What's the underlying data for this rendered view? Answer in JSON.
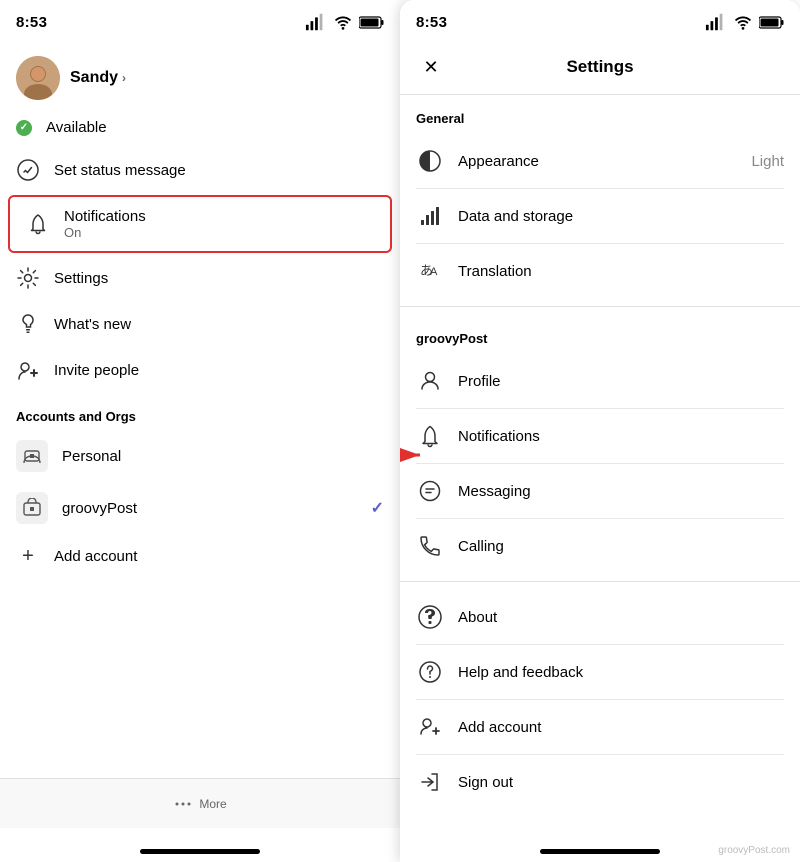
{
  "left": {
    "statusBar": {
      "time": "8:53",
      "signal": "▌▌▌",
      "wifi": "WiFi",
      "battery": "🔋"
    },
    "user": {
      "name": "Sandy",
      "chevron": "›"
    },
    "menuItems": [
      {
        "id": "available",
        "icon": "dot-green",
        "label": "Available",
        "sublabel": ""
      },
      {
        "id": "status",
        "icon": "pencil-circle",
        "label": "Set status message",
        "sublabel": ""
      },
      {
        "id": "notifications",
        "icon": "bell",
        "label": "Notifications",
        "sublabel": "On",
        "highlighted": true
      },
      {
        "id": "settings",
        "icon": "gear",
        "label": "Settings",
        "sublabel": ""
      },
      {
        "id": "whats-new",
        "icon": "bulb",
        "label": "What's new",
        "sublabel": ""
      },
      {
        "id": "invite",
        "icon": "person-plus",
        "label": "Invite people",
        "sublabel": ""
      }
    ],
    "accountsTitle": "Accounts and Orgs",
    "accounts": [
      {
        "id": "personal",
        "icon": "home",
        "label": "Personal",
        "check": false
      },
      {
        "id": "groovypost",
        "icon": "briefcase",
        "label": "groovyPost",
        "check": true
      }
    ],
    "addAccount": "+ Add account",
    "moreLabel": "More"
  },
  "right": {
    "statusBar": {
      "time": "8:53"
    },
    "title": "Settings",
    "closeLabel": "✕",
    "sections": [
      {
        "title": "General",
        "items": [
          {
            "id": "appearance",
            "icon": "half-circle",
            "label": "Appearance",
            "value": "Light"
          },
          {
            "id": "data-storage",
            "icon": "bar-chart",
            "label": "Data and storage",
            "value": ""
          },
          {
            "id": "translation",
            "icon": "translation",
            "label": "Translation",
            "value": ""
          }
        ]
      },
      {
        "title": "groovyPost",
        "items": [
          {
            "id": "profile",
            "icon": "person",
            "label": "Profile",
            "value": ""
          },
          {
            "id": "notifications",
            "icon": "bell",
            "label": "Notifications",
            "value": ""
          },
          {
            "id": "messaging",
            "icon": "message",
            "label": "Messaging",
            "value": ""
          },
          {
            "id": "calling",
            "icon": "phone",
            "label": "Calling",
            "value": ""
          }
        ]
      },
      {
        "title": "",
        "items": [
          {
            "id": "about",
            "icon": "teams",
            "label": "About",
            "value": ""
          },
          {
            "id": "help",
            "icon": "question",
            "label": "Help and feedback",
            "value": ""
          },
          {
            "id": "add-account",
            "icon": "person-add",
            "label": "Add account",
            "value": ""
          },
          {
            "id": "sign-out",
            "icon": "sign-out",
            "label": "Sign out",
            "value": ""
          }
        ]
      }
    ],
    "watermark": "groovyPost.com"
  }
}
